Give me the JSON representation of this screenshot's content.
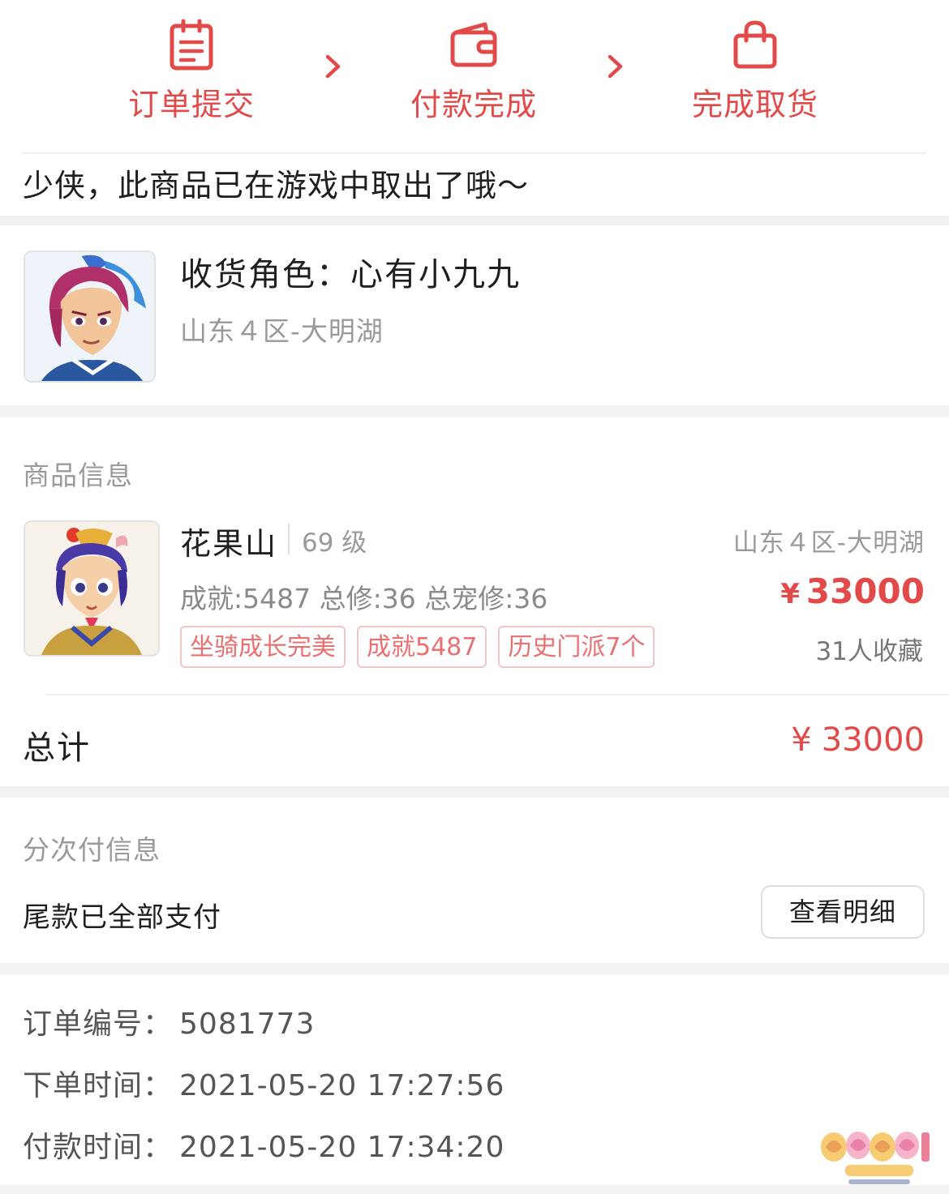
{
  "steps": [
    {
      "label": "订单提交",
      "icon": "order-form-icon"
    },
    {
      "label": "付款完成",
      "icon": "wallet-icon"
    },
    {
      "label": "完成取货",
      "icon": "shopping-bag-icon"
    }
  ],
  "notice": "少侠，此商品已在游戏中取出了哦～",
  "receiver": {
    "title": "收货角色：心有小九九",
    "server": "山东４区-大明湖"
  },
  "product_section": {
    "label": "商品信息",
    "name": "花果山",
    "level": "69 级",
    "stats": "成就:5487 总修:36 总宠修:36",
    "server": "山东４区-大明湖",
    "currency": "¥",
    "price": "33000",
    "favorites": "31人收藏",
    "tags": [
      "坐骑成长完美",
      "成就5487",
      "历史门派7个"
    ]
  },
  "total": {
    "label": "总计",
    "currency": "¥",
    "value": "33000"
  },
  "installment": {
    "label": "分次付信息",
    "status": "尾款已全部支付",
    "button": "查看明细"
  },
  "order_info": {
    "number_label": "订单编号：",
    "number": "5081773",
    "created_label": "下单时间：",
    "created": "2021-05-20 17:27:56",
    "paid_label": "付款时间：",
    "paid": "2021-05-20 17:34:20"
  },
  "colors": {
    "accent": "#e24a4a",
    "tag_border": "#f3c4c4",
    "gap": "#f2f2f2"
  }
}
